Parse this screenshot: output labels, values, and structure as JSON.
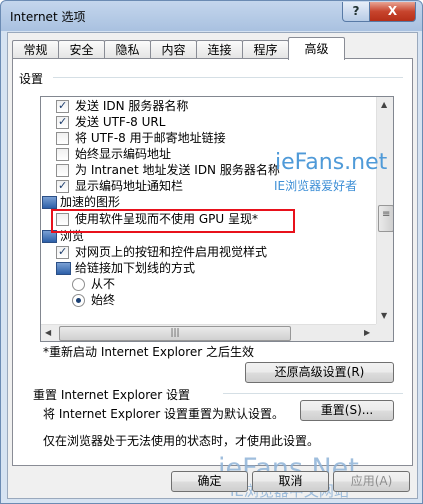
{
  "window": {
    "title": "Internet 选项",
    "help_label": "?",
    "close_label": "X"
  },
  "tabs": [
    "常规",
    "安全",
    "隐私",
    "内容",
    "连接",
    "程序",
    "高级"
  ],
  "settings_group": {
    "label": "设置"
  },
  "list_items": [
    {
      "type": "checkbox",
      "checked": true,
      "label": "发送 IDN 服务器名称"
    },
    {
      "type": "checkbox",
      "checked": true,
      "label": "发送 UTF-8 URL"
    },
    {
      "type": "checkbox",
      "checked": false,
      "label": "将 UTF-8 用于邮寄地址链接"
    },
    {
      "type": "checkbox",
      "checked": false,
      "label": "始终显示编码地址"
    },
    {
      "type": "checkbox",
      "checked": false,
      "label": "为 Intranet 地址发送 IDN 服务器名称"
    },
    {
      "type": "checkbox",
      "checked": true,
      "label": "显示编码地址通知栏"
    },
    {
      "type": "category",
      "label": "加速的图形"
    },
    {
      "type": "checkbox",
      "checked": false,
      "label": "使用软件呈现而不使用 GPU 呈现*"
    },
    {
      "type": "category",
      "label": "浏览"
    },
    {
      "type": "checkbox",
      "checked": true,
      "label": "对网页上的按钮和控件启用视觉样式"
    },
    {
      "type": "category",
      "label": "给链接加下划线的方式"
    },
    {
      "type": "radio",
      "checked": false,
      "label": "从不"
    },
    {
      "type": "radio",
      "checked": true,
      "label": "始终"
    }
  ],
  "restart_note": "*重新启动 Internet Explorer 之后生效",
  "restore_button": "还原高级设置(R)",
  "reset_section": {
    "title": "重置 Internet Explorer 设置",
    "description": "将 Internet Explorer 设置重置为默认设置。",
    "button": "重置(S)...",
    "note": "仅在浏览器处于无法使用的状态时，才使用此设置。"
  },
  "footer": {
    "ok": "确定",
    "cancel": "取消",
    "apply": "应用(A)"
  },
  "watermarks": {
    "top_brand": "ieFans.net",
    "top_sub": "IE浏览器爱好者",
    "bottom_brand": "ieFans.Net",
    "bottom_sub": "IE浏览器中文网站"
  }
}
